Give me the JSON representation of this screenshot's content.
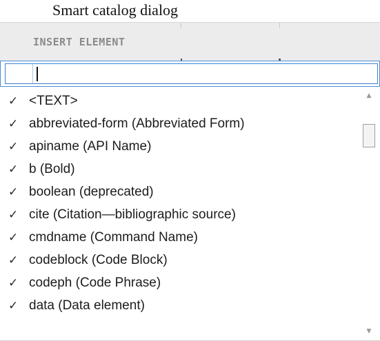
{
  "caption": "Smart catalog dialog",
  "dialog": {
    "title": "INSERT ELEMENT",
    "filter": {
      "value": "",
      "placeholder": ""
    },
    "check_glyph": "✓",
    "items": [
      {
        "label": "<TEXT>",
        "checked": true
      },
      {
        "label": "abbreviated-form (Abbreviated Form)",
        "checked": true
      },
      {
        "label": "apiname (API Name)",
        "checked": true
      },
      {
        "label": "b (Bold)",
        "checked": true
      },
      {
        "label": "boolean (deprecated)",
        "checked": true
      },
      {
        "label": "cite (Citation—bibliographic source)",
        "checked": true
      },
      {
        "label": "cmdname (Command Name)",
        "checked": true
      },
      {
        "label": "codeblock (Code Block)",
        "checked": true
      },
      {
        "label": "codeph (Code Phrase)",
        "checked": true
      },
      {
        "label": "data (Data element)",
        "checked": true
      }
    ],
    "scrollbar": {
      "up_glyph": "▲",
      "down_glyph": "▼"
    }
  },
  "colors": {
    "header_bg": "#ececec",
    "focus_border": "#3c7fd1",
    "title_text": "#8a8a8a"
  }
}
